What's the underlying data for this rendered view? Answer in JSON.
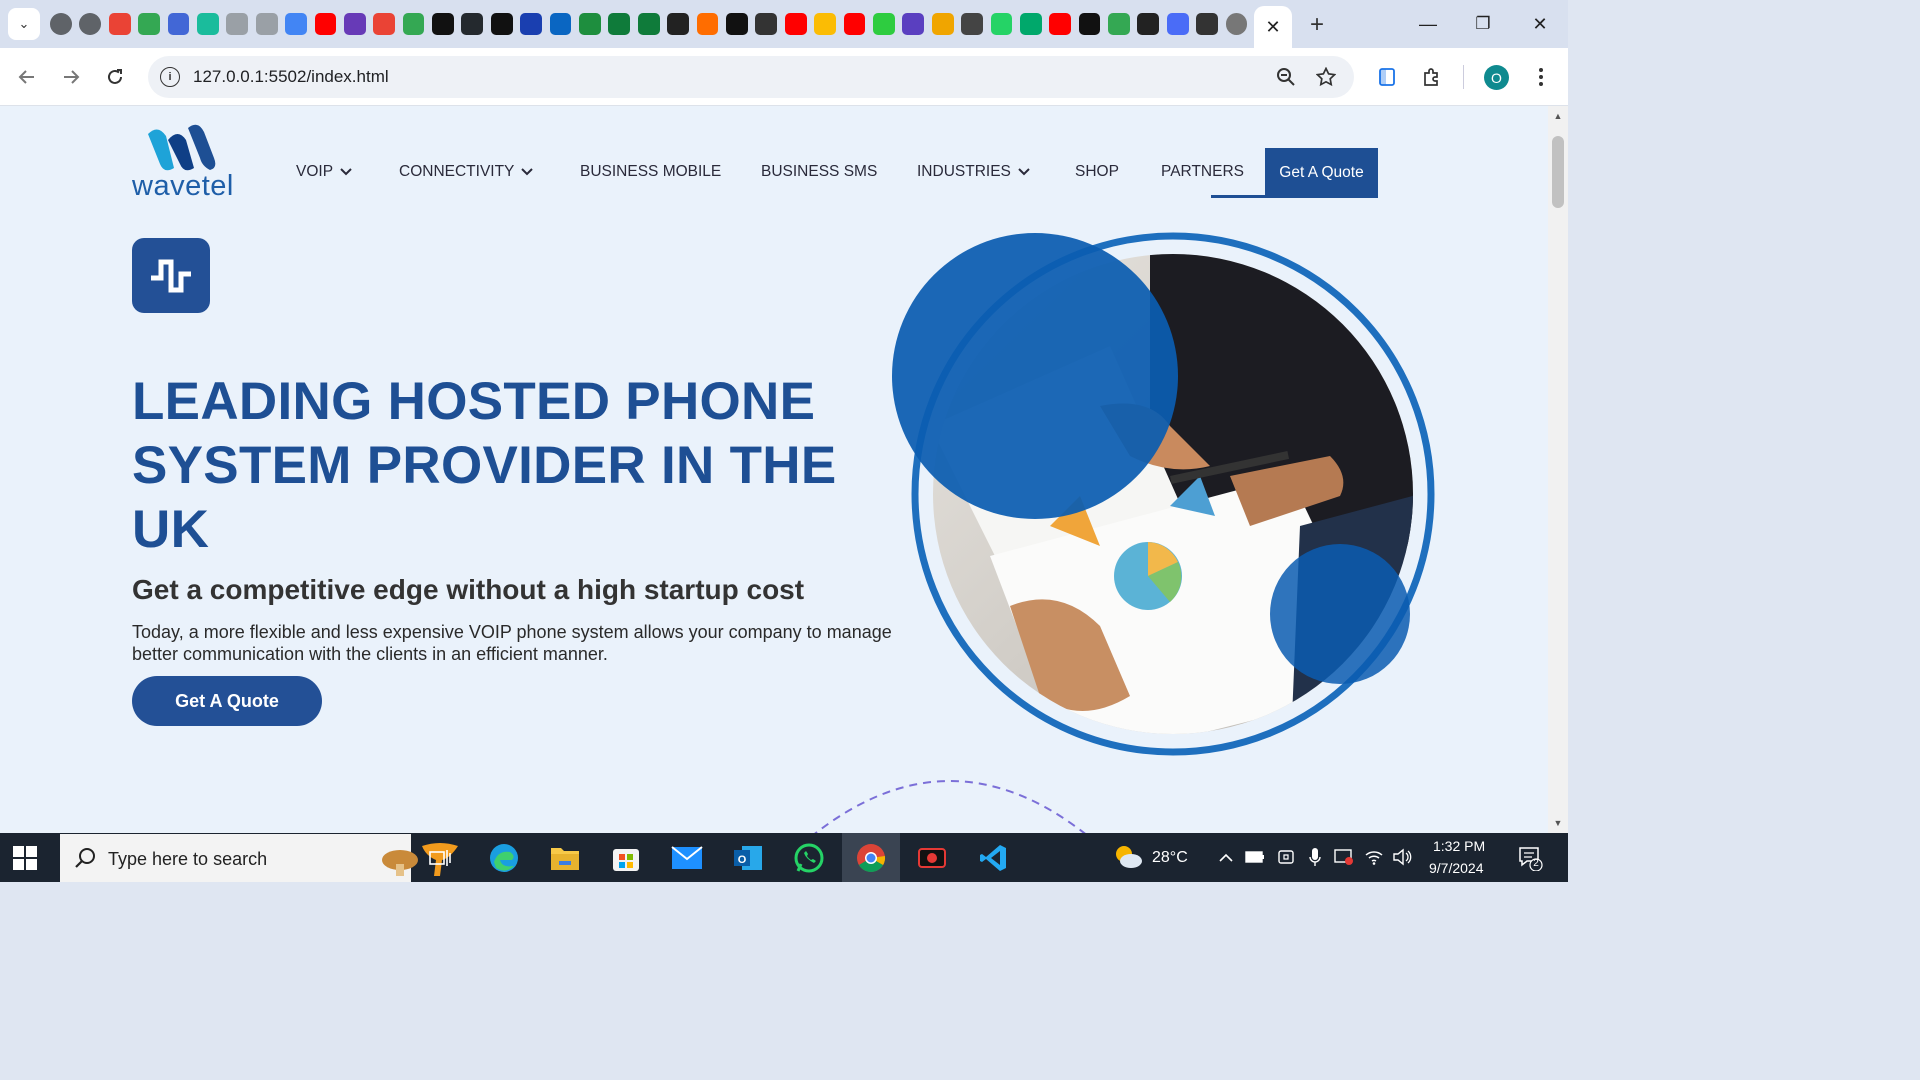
{
  "browser": {
    "tab_icon_colors": [
      "#5f6368",
      "#5f6368",
      "#ea4335",
      "#34a853",
      "#4267d6",
      "#1abc9c",
      "#9aa0a6",
      "#9aa0a6",
      "#4285f4",
      "#ff0000",
      "#673ab7",
      "#ea4335",
      "#34a853",
      "#111111",
      "#24292e",
      "#111111",
      "#1a3fb0",
      "#0a66c2",
      "#1e8e3e",
      "#0f7b3a",
      "#0f7b3a",
      "#222222",
      "#ff6d00",
      "#111111",
      "#333333",
      "#ff0000",
      "#fbbc04",
      "#ff0000",
      "#2ecc40",
      "#5a3fc0",
      "#f0a500",
      "#444444",
      "#25d366",
      "#00a86b",
      "#ff0000",
      "#111111",
      "#34a853",
      "#222222",
      "#4a6cf7",
      "#333333",
      "#777777"
    ],
    "active_tab_close": "✕",
    "new_tab": "+",
    "window_controls": {
      "minimize": "—",
      "restore": "❐",
      "close": "✕"
    },
    "url": "127.0.0.1:5502/index.html",
    "profile_initial": "O",
    "icons": {
      "back": "arrow-left-icon",
      "forward": "arrow-right-icon",
      "reload": "reload-icon",
      "zoom": "magnifier-zoom-icon",
      "bookmark": "star-icon",
      "reading": "side-panel-icon",
      "extensions": "puzzle-icon",
      "menu": "kebab-menu-icon"
    }
  },
  "site": {
    "logo_text": "wavetel",
    "nav": {
      "items": [
        {
          "label": "VOIP",
          "dropdown": true
        },
        {
          "label": "CONNECTIVITY",
          "dropdown": true
        },
        {
          "label": "BUSINESS MOBILE",
          "dropdown": false
        },
        {
          "label": "BUSINESS SMS",
          "dropdown": false
        },
        {
          "label": "INDUSTRIES",
          "dropdown": true
        },
        {
          "label": "SHOP",
          "dropdown": false
        },
        {
          "label": "PARTNERS",
          "dropdown": false
        }
      ],
      "cta_label": "Get A Quote"
    },
    "hero": {
      "title": "LEADING HOSTED PHONE SYSTEM PROVIDER IN THE UK",
      "subtitle": "Get a competitive edge without a high startup cost",
      "description": "Today, a more flexible and less expensive VOIP phone system allows your company to manage better communication with the clients in an efficient manner.",
      "cta_label": "Get A Quote"
    },
    "colors": {
      "primary": "#1e4f94",
      "accent": "#1e6fbe",
      "background": "#eaf2fb"
    }
  },
  "taskbar": {
    "search_placeholder": "Type here to search",
    "weather": "28°C",
    "time": "1:32 PM",
    "date": "9/7/2024",
    "notification_count": "2",
    "apps": [
      "task-view-icon",
      "edge-icon",
      "file-explorer-icon",
      "microsoft-store-icon",
      "mail-icon",
      "outlook-icon",
      "whatsapp-icon",
      "chrome-icon",
      "screen-recorder-icon",
      "vscode-icon"
    ]
  }
}
